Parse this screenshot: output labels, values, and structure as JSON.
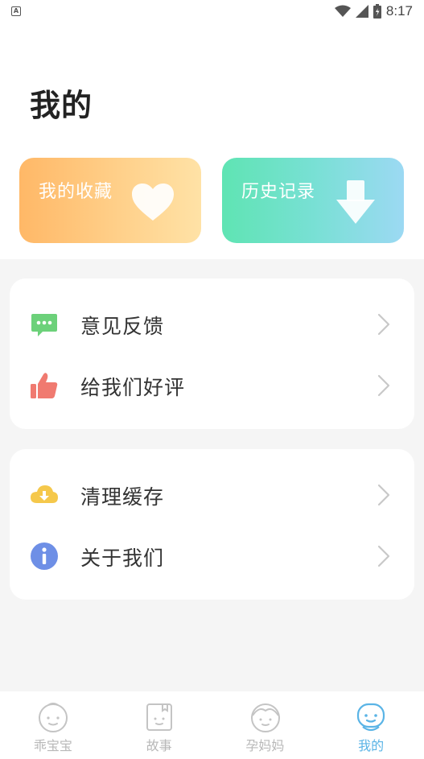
{
  "status_bar": {
    "notification_badge": "A",
    "time": "8:17",
    "icons": [
      "wifi-icon",
      "signal-icon",
      "battery-icon"
    ]
  },
  "header": {
    "title": "我的",
    "cards": [
      {
        "label": "我的收藏",
        "icon": "heart-icon",
        "gradient": [
          "#ffb867",
          "#ffe2a6"
        ]
      },
      {
        "label": "历史记录",
        "icon": "download-arrow-icon",
        "gradient": [
          "#5fe4b3",
          "#9cd9f3"
        ]
      }
    ]
  },
  "menu_groups": [
    {
      "items": [
        {
          "label": "意见反馈",
          "icon": "chat-bubble-icon",
          "color": "#6cd17a"
        },
        {
          "label": "给我们好评",
          "icon": "thumbs-up-icon",
          "color": "#f07a70"
        }
      ]
    },
    {
      "items": [
        {
          "label": "清理缓存",
          "icon": "cloud-download-icon",
          "color": "#f5c84b"
        },
        {
          "label": "关于我们",
          "icon": "info-icon",
          "color": "#6e8fe6"
        }
      ]
    }
  ],
  "bottom_nav": {
    "items": [
      {
        "label": "乖宝宝",
        "icon": "baby-icon",
        "active": false
      },
      {
        "label": "故事",
        "icon": "storybook-icon",
        "active": false
      },
      {
        "label": "孕妈妈",
        "icon": "mom-icon",
        "active": false
      },
      {
        "label": "我的",
        "icon": "profile-face-icon",
        "active": true
      }
    ],
    "active_color": "#5ab4e6",
    "inactive_color": "#b8b8b8"
  }
}
